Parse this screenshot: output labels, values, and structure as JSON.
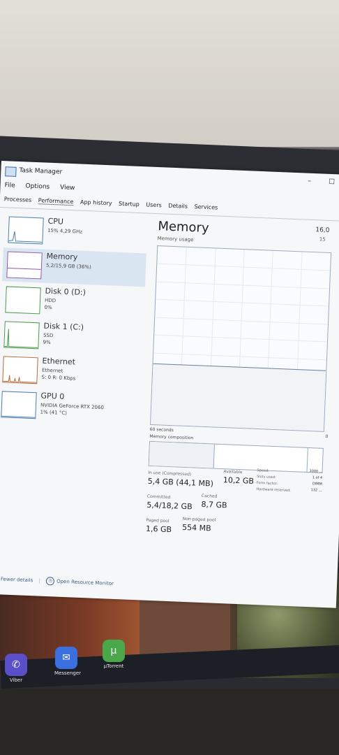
{
  "window": {
    "title": "Task Manager",
    "controls": {
      "minimize": "–",
      "maximize": "☐"
    }
  },
  "menu": [
    "File",
    "Options",
    "View"
  ],
  "tabs": [
    "Processes",
    "Performance",
    "App history",
    "Startup",
    "Users",
    "Details",
    "Services"
  ],
  "sidebar": {
    "items": [
      {
        "name": "CPU",
        "line1": "15% 4,29 GHz",
        "line2": ""
      },
      {
        "name": "Memory",
        "line1": "5,2/15,9 GB (36%)",
        "line2": ""
      },
      {
        "name": "Disk 0 (D:)",
        "line1": "HDD",
        "line2": "0%"
      },
      {
        "name": "Disk 1 (C:)",
        "line1": "SSD",
        "line2": "9%"
      },
      {
        "name": "Ethernet",
        "line1": "Ethernet",
        "line2": "S: 0 R: 0 Kbps"
      },
      {
        "name": "GPU 0",
        "line1": "NVIDIA GeForce RTX 2060",
        "line2": "1% (41 °C)"
      }
    ]
  },
  "memory": {
    "heading": "Memory",
    "usage_label": "Memory usage",
    "max_value": "16,0",
    "max_value_sub": "15",
    "time_label": "60 seconds",
    "zero_label": "0",
    "composition_label": "Memory composition",
    "usage_fraction": 0.34,
    "composition": {
      "in_use_fraction": 0.37,
      "cached_fraction": 0.54
    },
    "in_use": {
      "label": "In use (Compressed)",
      "value": "5,4 GB (44,1 MB)"
    },
    "available": {
      "label": "Available",
      "value": "10,2 GB"
    },
    "committed": {
      "label": "Committed",
      "value": "5,4/18,2 GB"
    },
    "cached": {
      "label": "Cached",
      "value": "8,7 GB"
    },
    "paged_pool": {
      "label": "Paged pool",
      "value": "1,6 GB"
    },
    "non_paged_pool": {
      "label": "Non-paged pool",
      "value": "554 MB"
    },
    "right_stats": {
      "speed_label": "Speed:",
      "speed_value": "3000 ...",
      "slots_label": "Slots used:",
      "slots_value": "1 of 4",
      "form_label": "Form factor:",
      "form_value": "DIMM",
      "hw_label": "Hardware reserved:",
      "hw_value": "132 ..."
    }
  },
  "footer": {
    "fewer_details": "Fewer details",
    "resource_monitor": "Open Resource Monitor"
  },
  "desktop": {
    "icons": [
      {
        "label": "Viber",
        "color": "#5a4fc8",
        "glyph": "✆"
      },
      {
        "label": "Messenger",
        "color": "#3b6fe0",
        "glyph": "✉"
      },
      {
        "label": "µTorrent",
        "color": "#4aa84a",
        "glyph": "µ"
      }
    ]
  }
}
